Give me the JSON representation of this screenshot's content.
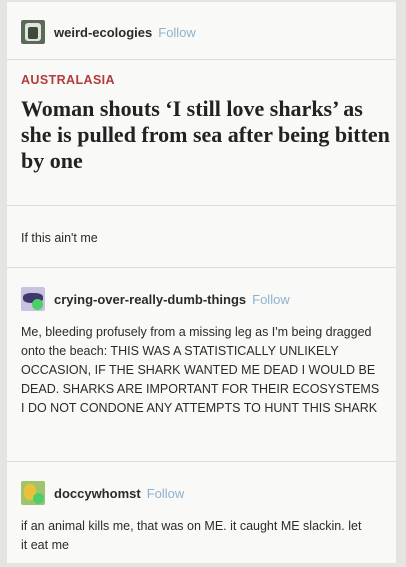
{
  "post": {
    "author": "weird-ecologies",
    "follow_label": "Follow",
    "article": {
      "section": "AUSTRALASIA",
      "headline": "Woman shouts ‘I still love sharks’ as she is pulled from sea after being bitten by one"
    },
    "caption": "If this ain't me"
  },
  "reblogs": [
    {
      "author": "crying-over-really-dumb-things",
      "follow_label": "Follow",
      "text": "Me, bleeding profusely from a missing leg as I'm being dragged onto the beach: THIS WAS A STATISTICALLY UNLIKELY OCCASION, IF THE SHARK WANTED ME DEAD I WOULD BE DEAD. SHARKS ARE IMPORTANT FOR THEIR ECOSYSTEMS I DO NOT CONDONE ANY ATTEMPTS TO HUNT THIS SHARK"
    },
    {
      "author": "doccywhomst",
      "follow_label": "Follow",
      "text": "if an animal kills me, that was on ME. it caught ME slackin. let it eat me"
    }
  ]
}
